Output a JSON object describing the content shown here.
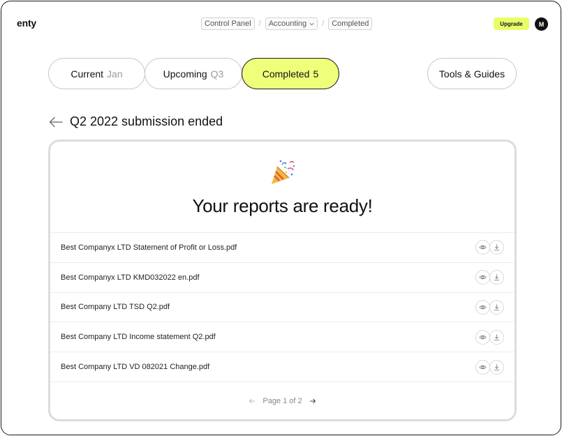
{
  "brand": {
    "logo": "enty"
  },
  "breadcrumb": {
    "items": [
      {
        "label": "Control Panel",
        "has_dropdown": false
      },
      {
        "label": "Accounting",
        "has_dropdown": true
      },
      {
        "label": "Completed",
        "has_dropdown": false
      }
    ],
    "separator": "/"
  },
  "header": {
    "upgrade_label": "Upgrade",
    "avatar_initial": "M",
    "upgrade_color": "#E8FF6A"
  },
  "tabs": [
    {
      "label": "Current",
      "sub": "Jan",
      "active": false
    },
    {
      "label": "Upcoming",
      "sub": "Q3",
      "active": false
    },
    {
      "label": "Completed",
      "sub": "5",
      "active": true
    },
    {
      "label": "Tools & Guides",
      "sub": "",
      "active": false
    }
  ],
  "accent_color": "#EFFF7A",
  "page": {
    "title": "Q2 2022 submission ended"
  },
  "card": {
    "emoji_icon": "party-popper-icon",
    "heading": "Your reports are ready!",
    "files": [
      {
        "name": "Best Companyx LTD Statement of Profit or Loss.pdf"
      },
      {
        "name": "Best Companyx LTD KMD032022 en.pdf"
      },
      {
        "name": "Best Company LTD TSD Q2.pdf"
      },
      {
        "name": "Best Company LTD Income statement Q2.pdf"
      },
      {
        "name": "Best Company LTD VD 082021 Change.pdf"
      }
    ],
    "pagination": {
      "label": "Page 1 of 2"
    }
  }
}
